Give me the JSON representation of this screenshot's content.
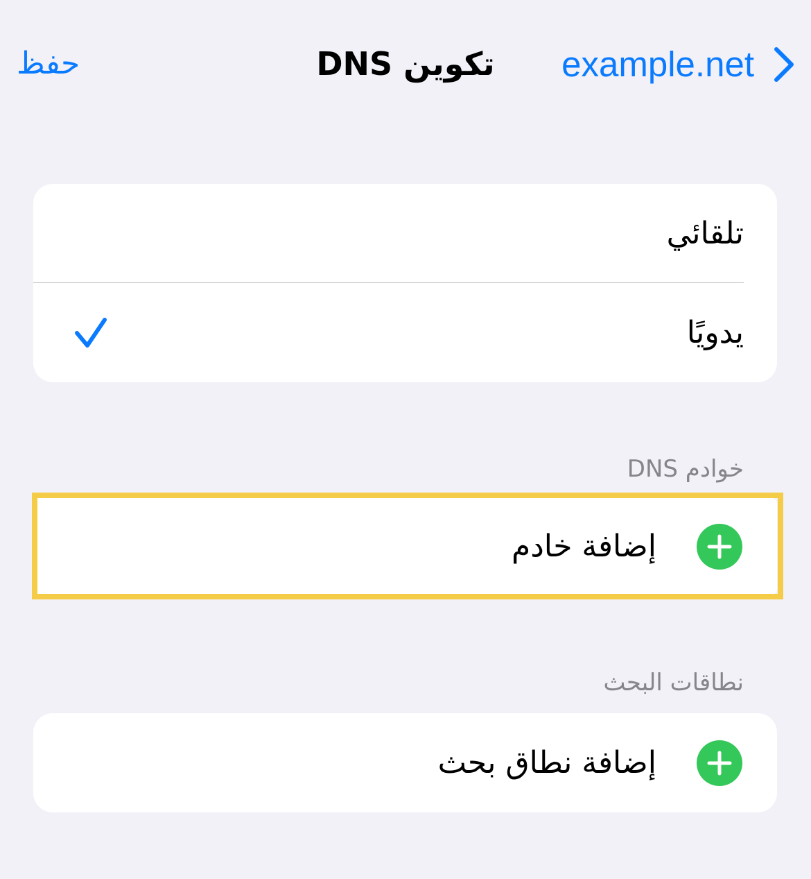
{
  "navbar": {
    "save_label": "حفظ",
    "title": "تكوين DNS",
    "back_label": "example.net",
    "back_icon": "chevron-right-icon"
  },
  "mode_options": [
    {
      "label": "تلقائي",
      "selected": false
    },
    {
      "label": "يدويًا",
      "selected": true
    }
  ],
  "dns_servers": {
    "header": "خوادم DNS",
    "add_label": "إضافة خادم",
    "icon": "plus-circle-icon"
  },
  "search_domains": {
    "header": "نطاقات البحث",
    "add_label": "إضافة نطاق بحث",
    "icon": "plus-circle-icon"
  },
  "colors": {
    "accent": "#0a7bff",
    "background": "#f2f1f7",
    "add_green": "#34c759",
    "highlight": "#f4cc48",
    "section_header": "#86858b"
  }
}
